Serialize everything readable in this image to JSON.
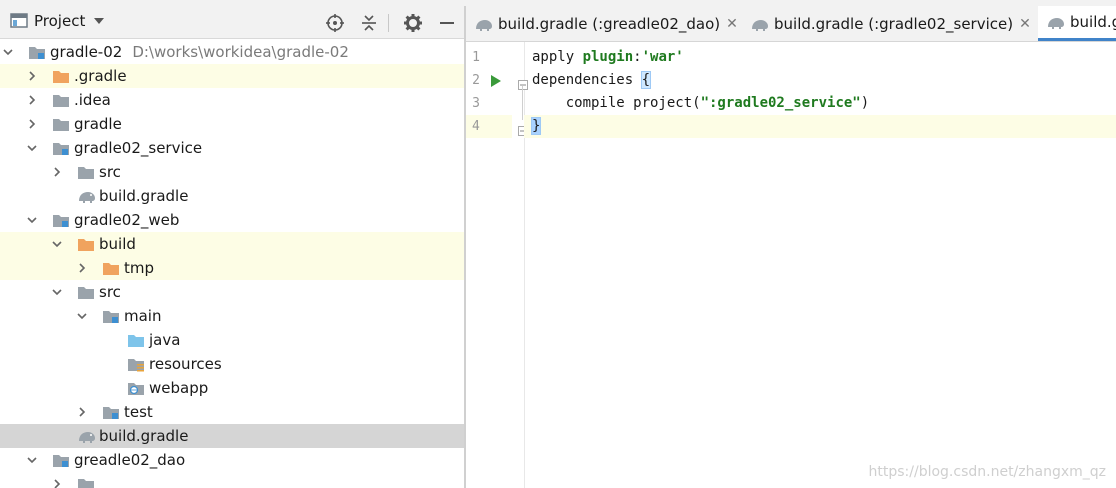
{
  "project_panel": {
    "title": "Project",
    "root": {
      "label": "gradle-02",
      "path": "D:\\works\\workidea\\gradle-02"
    },
    "items": [
      {
        "label": ".gradle"
      },
      {
        "label": ".idea"
      },
      {
        "label": "gradle"
      },
      {
        "label": "gradle02_service"
      },
      {
        "label": "src"
      },
      {
        "label": "build.gradle"
      },
      {
        "label": "gradle02_web"
      },
      {
        "label": "build"
      },
      {
        "label": "tmp"
      },
      {
        "label": "src"
      },
      {
        "label": "main"
      },
      {
        "label": "java"
      },
      {
        "label": "resources"
      },
      {
        "label": "webapp"
      },
      {
        "label": "test"
      },
      {
        "label": "build.gradle"
      },
      {
        "label": "greadle02_dao"
      }
    ]
  },
  "editor": {
    "tabs": [
      {
        "label": "build.gradle (:greadle02_dao)"
      },
      {
        "label": "build.gradle (:gradle02_service)"
      },
      {
        "label": "build.gr"
      }
    ],
    "lines": [
      {
        "num": "1",
        "t1": "apply ",
        "t2": "plugin",
        "t3": ":",
        "t4": "'war'"
      },
      {
        "num": "2",
        "t1": "dependencies ",
        "t2": "{"
      },
      {
        "num": "3",
        "t1": "    compile project(",
        "t2": "\":gradle02_service\"",
        "t3": ")"
      },
      {
        "num": "4",
        "t1": "}"
      }
    ]
  },
  "watermark": "https://blog.csdn.net/zhangxm_qz",
  "colors": {
    "highlight_row": "#fdfde5",
    "selected_row": "#d5d5d5",
    "folder_orange": "#f0a35e",
    "folder_gray": "#9aa3ab",
    "folder_blue": "#7ec4ea",
    "active_tab_underline": "#4083c9"
  }
}
